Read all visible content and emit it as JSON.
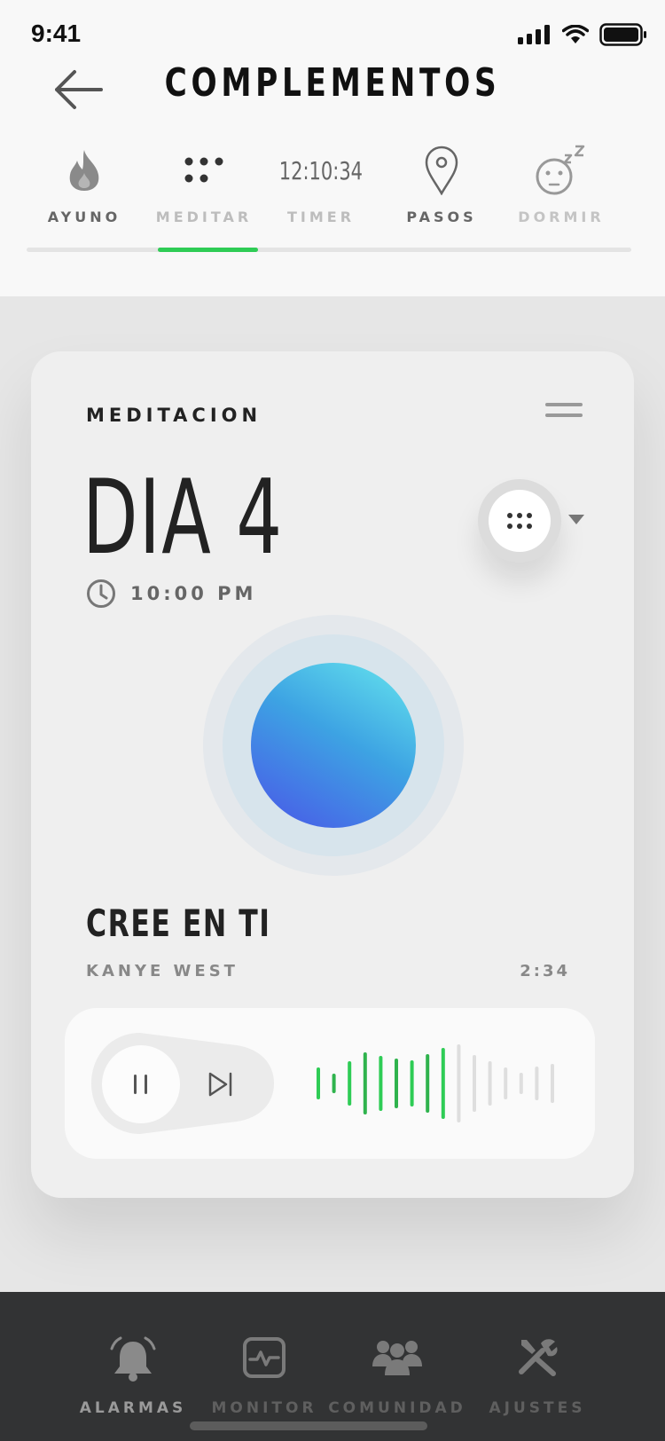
{
  "status": {
    "time": "9:41"
  },
  "header": {
    "title": "COMPLEMENTOS"
  },
  "tabs": [
    {
      "label": "AYUNO",
      "icon": "fire-icon",
      "active": false
    },
    {
      "label": "MEDITAR",
      "icon": "dots-icon",
      "active": true
    },
    {
      "label": "TIMER",
      "icon": "timer-text",
      "timer_value": "12:10:34",
      "active": false
    },
    {
      "label": "PASOS",
      "icon": "map-pin-icon",
      "active": false
    },
    {
      "label": "DORMIR",
      "icon": "sleep-face-icon",
      "active": false
    }
  ],
  "card": {
    "label": "MEDITACION",
    "day": "DIA 4",
    "time": "10:00 PM",
    "song_title": "CREE EN TI",
    "artist": "KANYE WEST",
    "duration": "2:34"
  },
  "player": {
    "progress": 0.48
  },
  "bottom_nav": [
    {
      "label": "ALARMAS",
      "icon": "bell-icon",
      "active": true
    },
    {
      "label": "MONITOR",
      "icon": "monitor-icon",
      "active": false
    },
    {
      "label": "COMUNIDAD",
      "icon": "community-icon",
      "active": false
    },
    {
      "label": "AJUSTES",
      "icon": "tools-icon",
      "active": false
    }
  ],
  "colors": {
    "accent": "#2ecc55",
    "orb_start": "#4a55e8",
    "orb_end": "#66e6ee"
  }
}
